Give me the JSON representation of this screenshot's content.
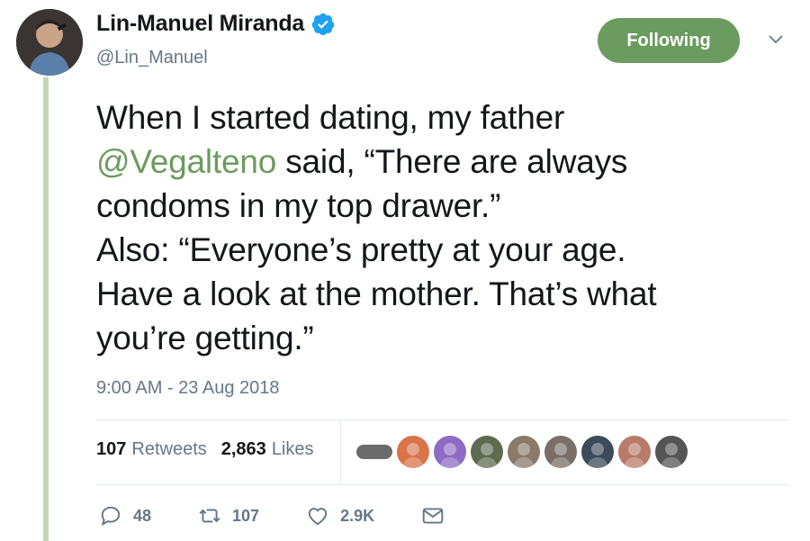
{
  "author": {
    "display_name": "Lin-Manuel Miranda",
    "handle": "@Lin_Manuel",
    "verified": true,
    "avatar_icon": "user-avatar"
  },
  "follow_button": {
    "label": "Following",
    "color": "#6c9b5f"
  },
  "menu_icon": "chevron-down-icon",
  "tweet": {
    "line1": "When I started dating, my father",
    "mention": "@Vegalteno",
    "line2_rest": " said, “There are always",
    "line3": "condoms in my top drawer.”",
    "line4": "Also: “Everyone’s pretty at your age.",
    "line5": "Have a look at the mother. That’s what",
    "line6": "you’re getting.”"
  },
  "timestamp": "9:00 AM - 23 Aug 2018",
  "stats": {
    "retweets_count": "107",
    "retweets_label": "Retweets",
    "likes_count": "2,863",
    "likes_label": "Likes"
  },
  "likers": [
    {
      "icon": "liker-avatar",
      "color": "#6b6b6b"
    },
    {
      "icon": "liker-avatar",
      "color": "#d9734a"
    },
    {
      "icon": "liker-avatar",
      "color": "#8e6bc4"
    },
    {
      "icon": "liker-avatar",
      "color": "#5f6b4f"
    },
    {
      "icon": "liker-avatar",
      "color": "#8a7a6a"
    },
    {
      "icon": "liker-avatar",
      "color": "#7a6e68"
    },
    {
      "icon": "liker-avatar",
      "color": "#3c4a5a"
    },
    {
      "icon": "liker-avatar",
      "color": "#b87a6a"
    },
    {
      "icon": "liker-avatar",
      "color": "#555555"
    }
  ],
  "actions": {
    "reply_count": "48",
    "retweet_count": "107",
    "like_count": "2.9K"
  },
  "colors": {
    "accent": "#6c9b5f",
    "secondary_text": "#657786",
    "thread_line": "#c5d6b6"
  }
}
